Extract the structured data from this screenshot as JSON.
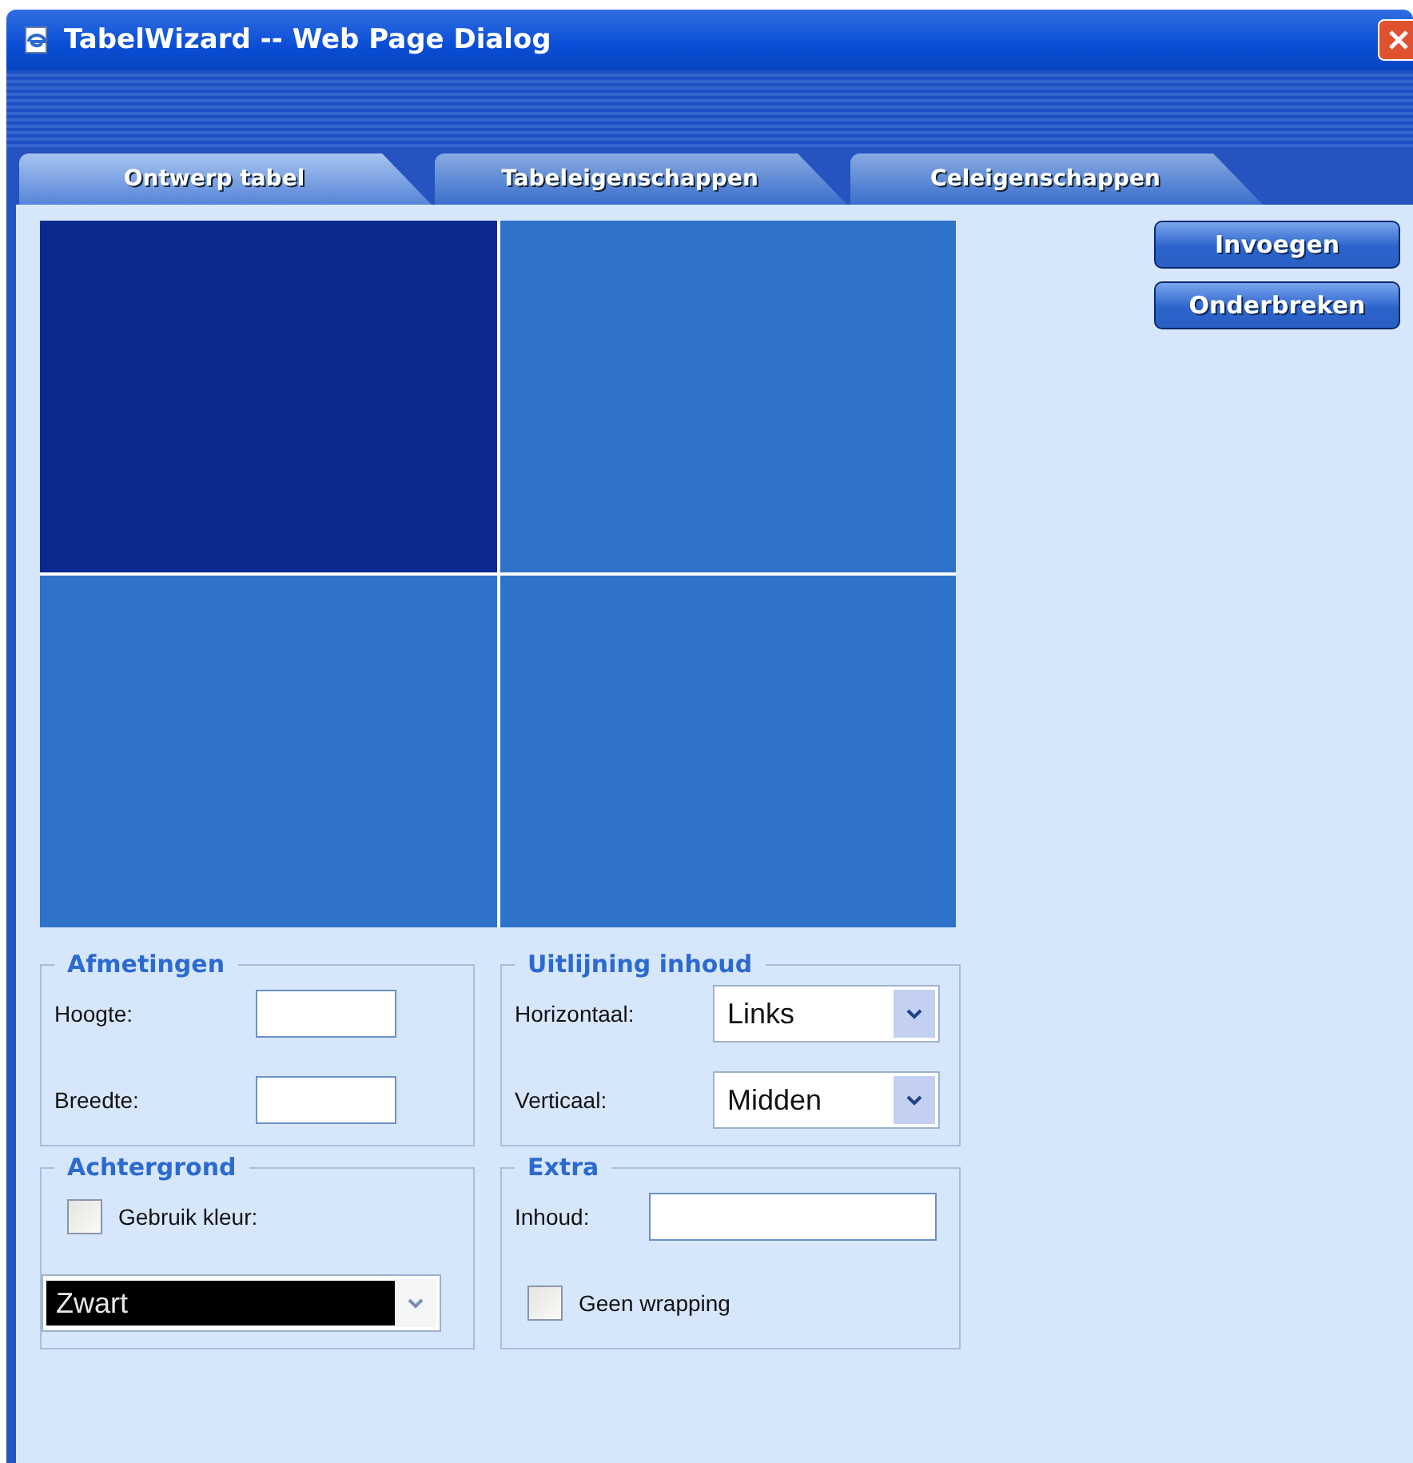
{
  "window": {
    "title": "TabelWizard -- Web Page Dialog"
  },
  "tabs": [
    {
      "label": "Ontwerp tabel",
      "selected": true
    },
    {
      "label": "Tabeleigenschappen",
      "selected": false
    },
    {
      "label": "Celeigenschappen",
      "selected": false
    }
  ],
  "preview_cells": [
    {
      "selected": true
    },
    {
      "selected": false
    },
    {
      "selected": false
    },
    {
      "selected": false
    }
  ],
  "buttons": [
    "Invoegen",
    "Onderbreken"
  ],
  "afmetingen": {
    "title": "Afmetingen",
    "fields": [
      {
        "label": "Hoogte:"
      },
      {
        "label": "Breedte:"
      }
    ]
  },
  "uitlijning": {
    "title": "Uitlijning inhoud",
    "selects": [
      {
        "label": "Horizontaal:",
        "value": "Links"
      },
      {
        "label": "Verticaal:",
        "value": "Midden"
      }
    ]
  },
  "achtergrond": {
    "title": "Achtergrond",
    "checkbox": {
      "label": "Gebruik kleur:",
      "checked": false
    },
    "select": {
      "value": "Zwart",
      "disabled": true
    }
  },
  "extra": {
    "title": "Extra",
    "field": {
      "label": "Inhoud:"
    },
    "checkbox": {
      "label": "Geen wrapping",
      "checked": false
    }
  }
}
